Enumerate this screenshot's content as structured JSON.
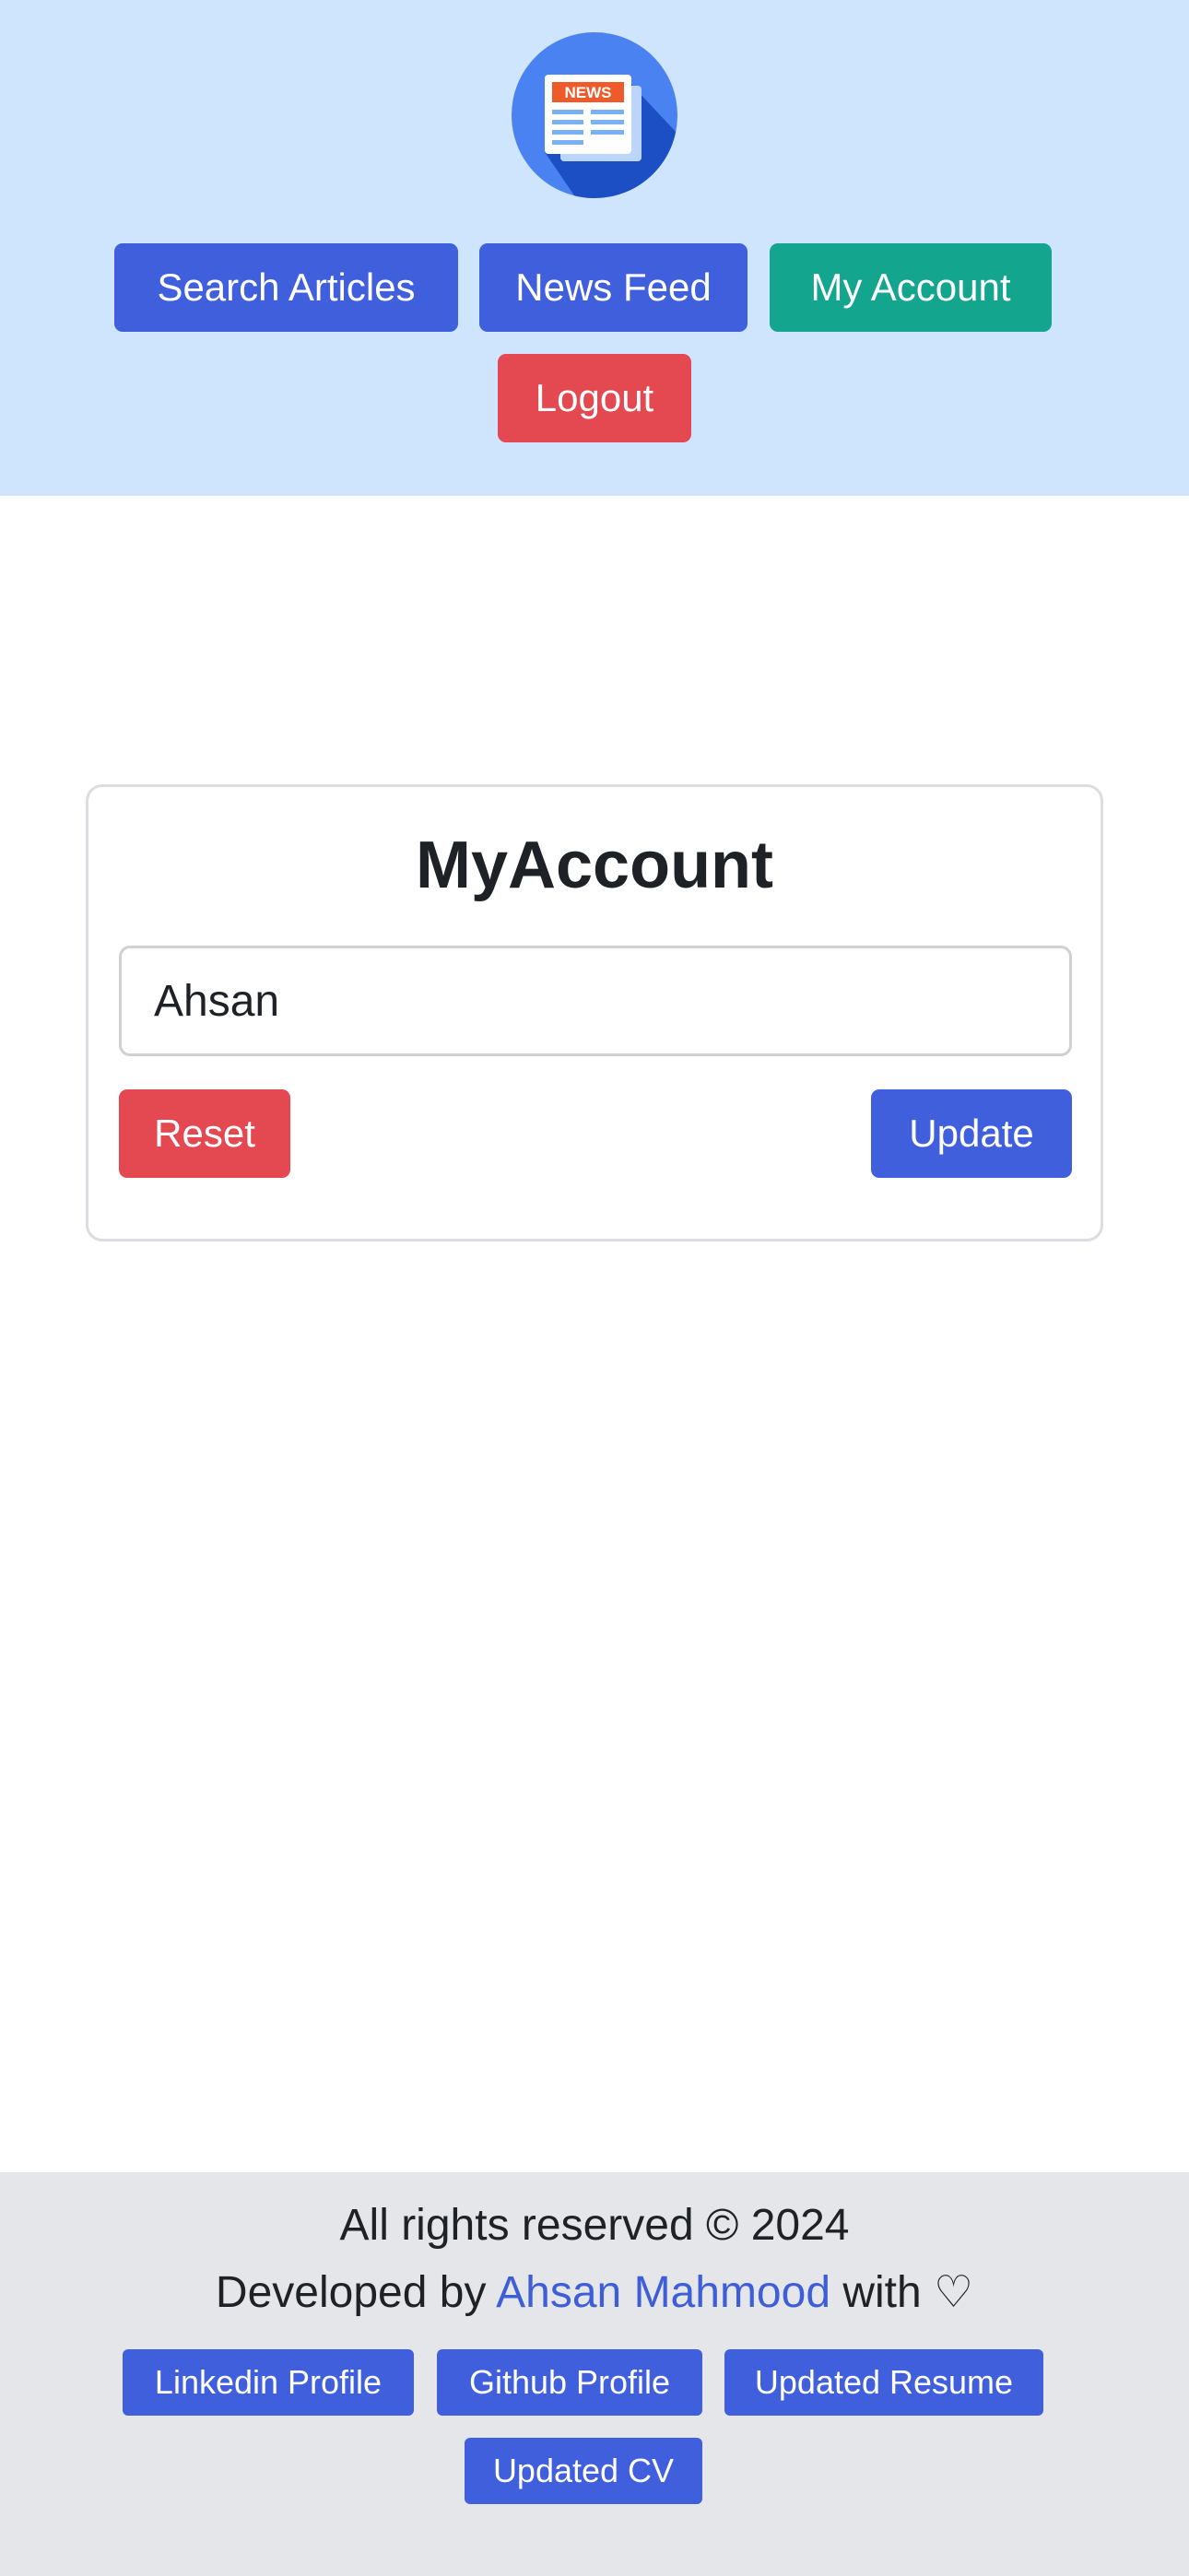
{
  "header": {
    "logo_text": "NEWS",
    "nav": {
      "search_articles": "Search Articles",
      "news_feed": "News Feed",
      "my_account": "My Account",
      "logout": "Logout"
    }
  },
  "account": {
    "title": "MyAccount",
    "name_value": "Ahsan",
    "reset_label": "Reset",
    "update_label": "Update"
  },
  "footer": {
    "rights": "All rights reserved © 2024",
    "developed_prefix": "Developed by ",
    "developer_name": "Ahsan Mahmood",
    "developed_suffix": " with ♡",
    "links": {
      "linkedin": "Linkedin Profile",
      "github": "Github Profile",
      "resume": "Updated Resume",
      "cv": "Updated CV"
    }
  },
  "colors": {
    "header_bg": "#cfe4fd",
    "primary": "#405fdc",
    "active": "#13a58d",
    "danger": "#e44850",
    "footer_bg": "#e5e6ea"
  }
}
